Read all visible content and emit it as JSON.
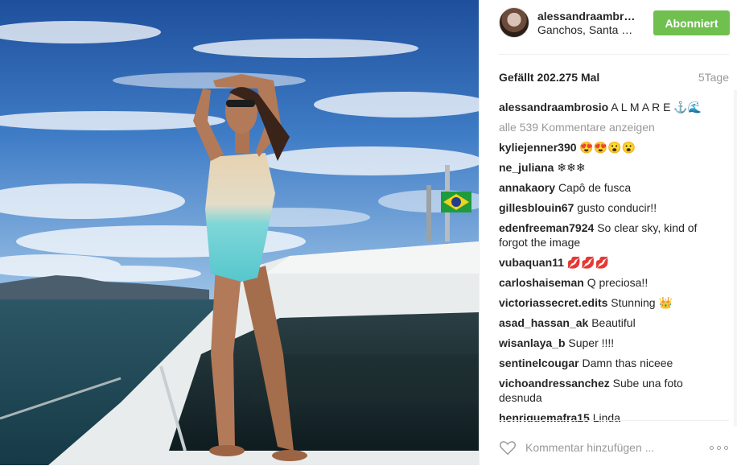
{
  "post": {
    "username": "alessandraambrosio",
    "location": "Ganchos, Santa Catarina",
    "follow_label": "Abonniert",
    "likes_text": "Gefällt 202.275 Mal",
    "age_text": "5Tage"
  },
  "comments": [
    {
      "user": "alessandraambrosio",
      "text": "A L M A R E ⚓🌊"
    },
    {
      "user": "",
      "text": "alle 539 Kommentare anzeigen"
    },
    {
      "user": "kyliejenner390",
      "text": "😍😍😮😮"
    },
    {
      "user": "ne_juliana",
      "text": "❄❄❄"
    },
    {
      "user": "annakaory",
      "text": "Capô de fusca"
    },
    {
      "user": "gillesblouin67",
      "text": "gusto conducir!!"
    },
    {
      "user": "edenfreeman7924",
      "text": "So clear sky, kind of forgot the image"
    },
    {
      "user": "vubaquan11",
      "text": "💋💋💋"
    },
    {
      "user": "carloshaiseman",
      "text": "Q preciosa!!"
    },
    {
      "user": "victoriassecret.edits",
      "text": "Stunning 👑"
    },
    {
      "user": "asad_hassan_ak",
      "text": "Beautiful"
    },
    {
      "user": "wisanlaya_b",
      "text": "Super !!!!"
    },
    {
      "user": "sentinelcougar",
      "text": "Damn thas niceee"
    },
    {
      "user": "vichoandressanchez",
      "text": "Sube una foto desnuda"
    },
    {
      "user": "henriquemafra15",
      "text": "Linda"
    }
  ],
  "footer": {
    "comment_placeholder": "Kommentar hinzufügen ...",
    "like_icon": "heart-outline-icon",
    "more_icon": "more-options-icon"
  },
  "colors": {
    "follow_green": "#70c050",
    "muted_text": "#999999",
    "divider": "#efefef"
  }
}
